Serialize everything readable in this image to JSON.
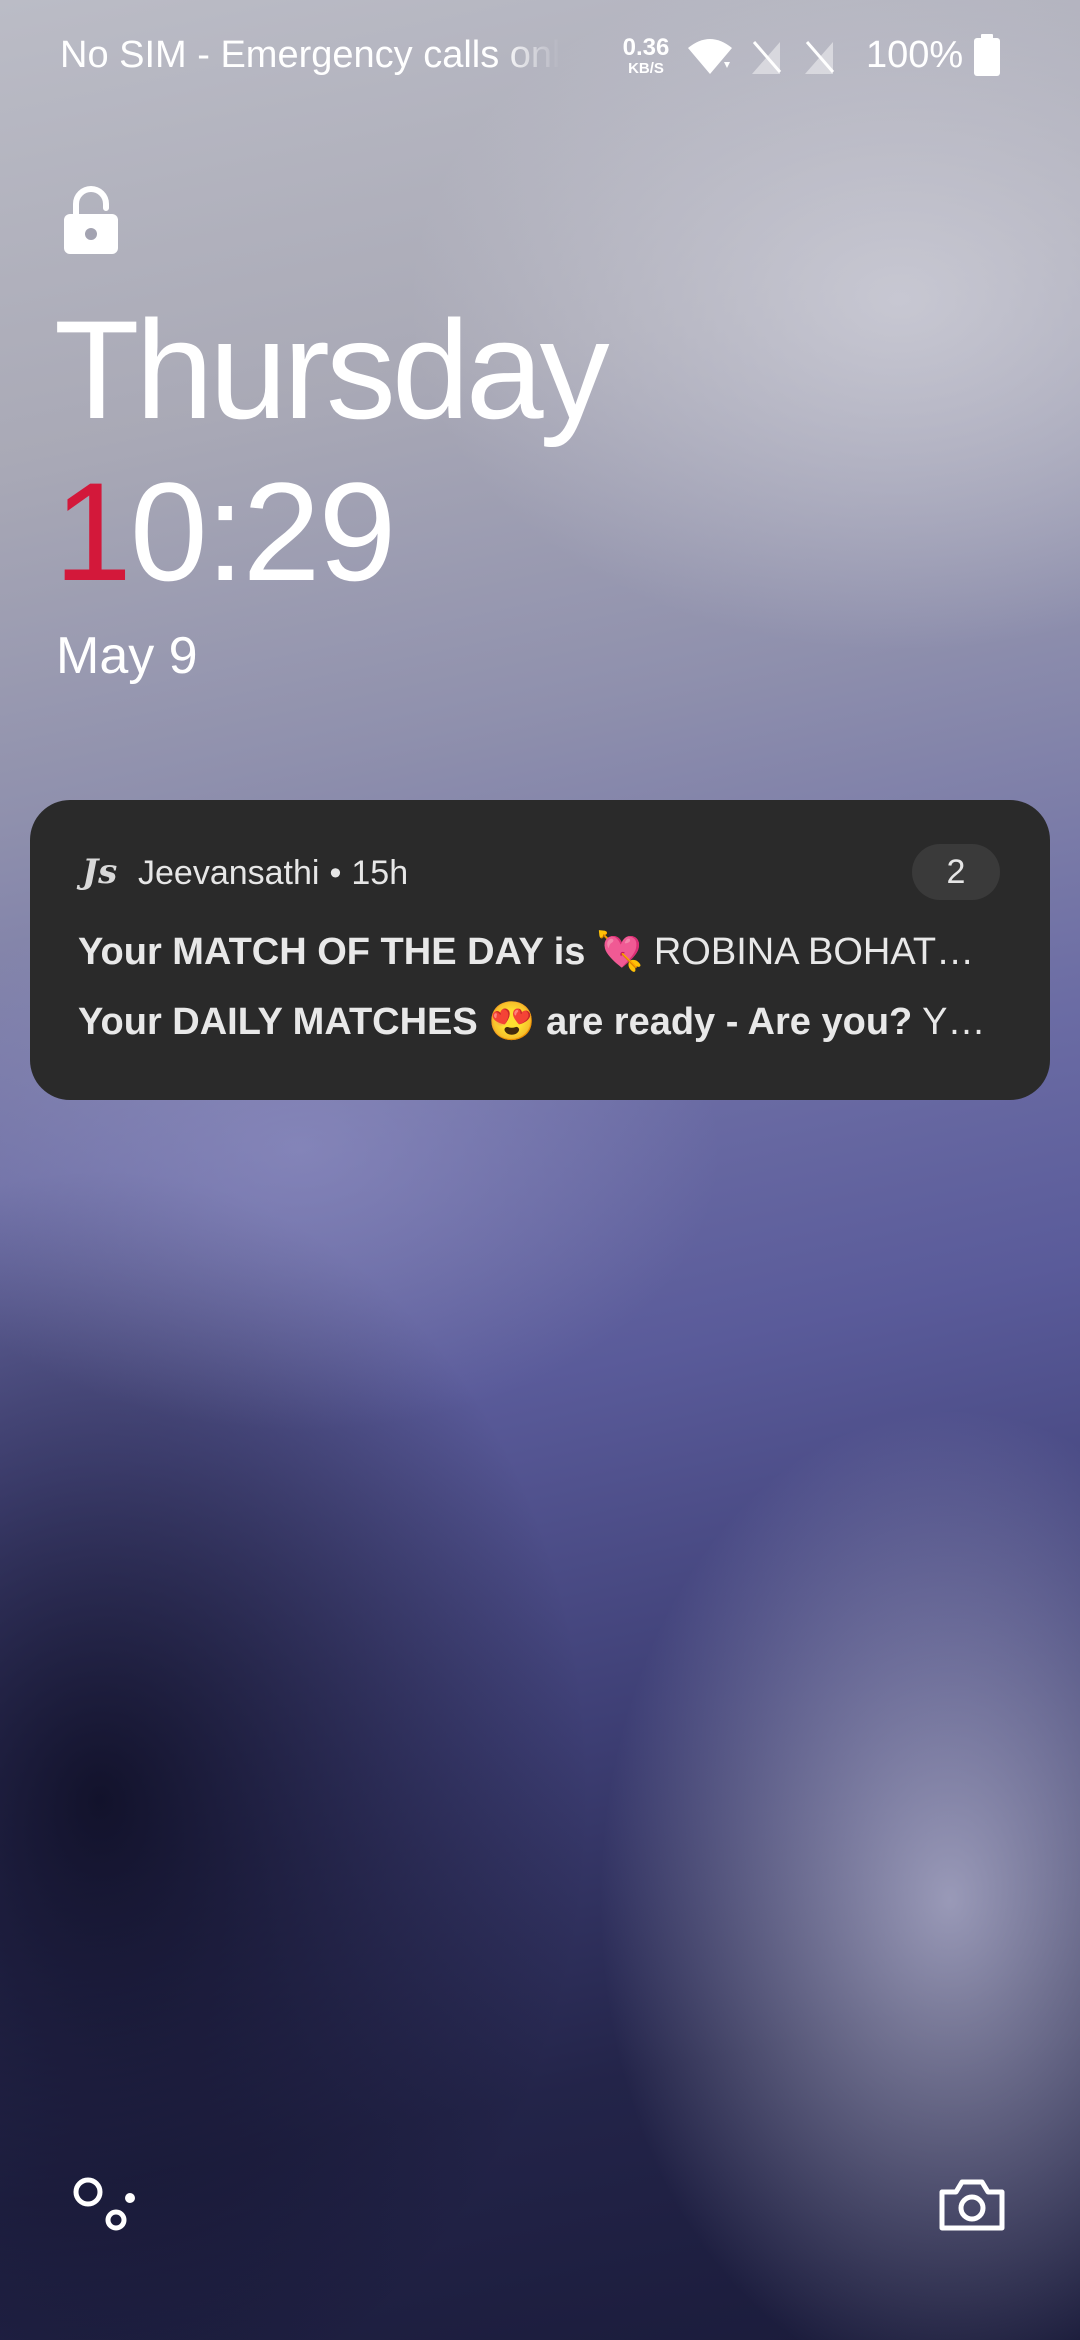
{
  "status_bar": {
    "carrier_text": "No SIM - Emergency calls only",
    "net_speed_value": "0.36",
    "net_speed_unit": "KB/S",
    "battery_percent": "100%",
    "icons": [
      "wifi-icon",
      "no-sim-icon",
      "no-sim-icon",
      "battery-icon"
    ]
  },
  "lock_screen": {
    "lock_icon": "lock-icon",
    "day": "Thursday",
    "time_first_digit": "1",
    "time_rest": "0:29",
    "date": "May 9",
    "accent_color": "#d3183a"
  },
  "notification": {
    "app_icon_text": "Js",
    "app_name": "Jeevansathi",
    "separator": "•",
    "age": "15h",
    "count": "2",
    "messages": [
      {
        "title": "Your MATCH OF THE DAY is 💘",
        "body": "ROBINA BOHAT…"
      },
      {
        "title": "Your DAILY MATCHES 😍 are ready - Are you?",
        "body": "Y…"
      }
    ]
  },
  "bottom_actions": {
    "left_icon": "assistant-icon",
    "right_icon": "camera-icon"
  }
}
